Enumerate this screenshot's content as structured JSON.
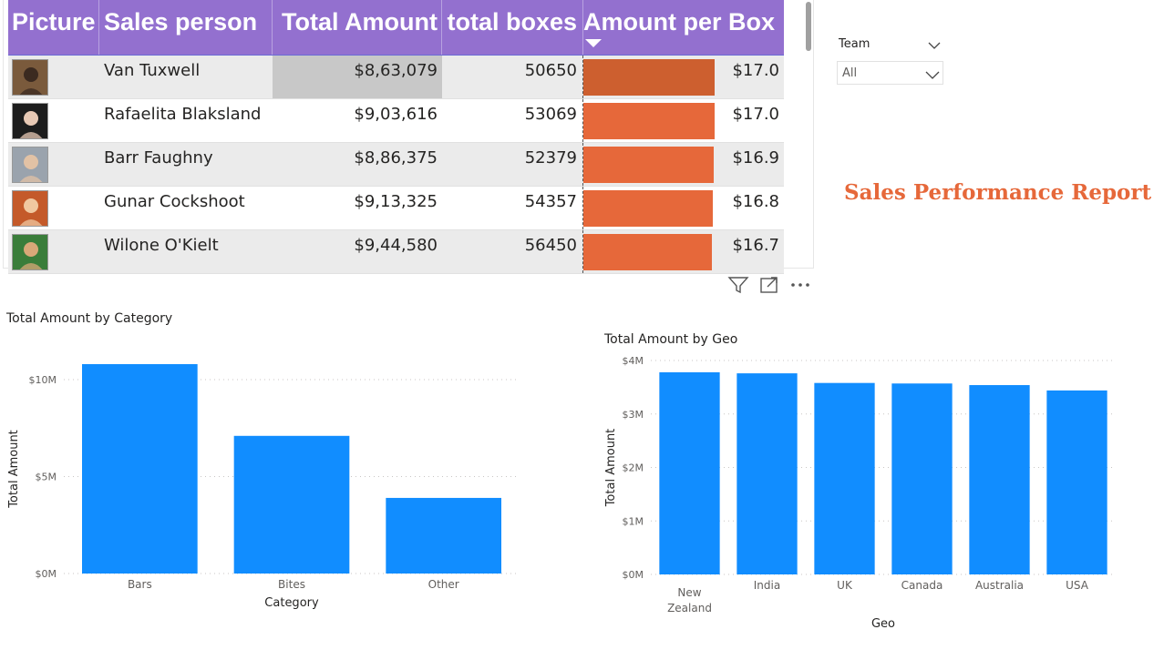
{
  "table": {
    "headers": {
      "picture": "Picture",
      "sales_person": "Sales person",
      "total_amount": "Total Amount",
      "total_boxes": "total boxes",
      "amount_per_box": "Amount per Box"
    },
    "sorted_column": "amount_per_box",
    "sort_direction": "descending",
    "header_color": "#9370cf",
    "databar_color": "#e6683a",
    "rows": [
      {
        "name": "Van Tuxwell",
        "amount": "$8,63,079",
        "boxes": "50650",
        "per_box": "$17.0",
        "per_box_value": 17.04,
        "selected": true
      },
      {
        "name": "Rafaelita Blaksland",
        "amount": "$9,03,616",
        "boxes": "53069",
        "per_box": "$17.0",
        "per_box_value": 17.03
      },
      {
        "name": "Barr Faughny",
        "amount": "$8,86,375",
        "boxes": "52379",
        "per_box": "$16.9",
        "per_box_value": 16.92
      },
      {
        "name": "Gunar Cockshoot",
        "amount": "$9,13,325",
        "boxes": "54357",
        "per_box": "$16.8",
        "per_box_value": 16.8
      },
      {
        "name": "Wilone O'Kielt",
        "amount": "$9,44,580",
        "boxes": "56450",
        "per_box": "$16.7",
        "per_box_value": 16.73
      }
    ]
  },
  "visual_header": {
    "icons": [
      "filter-icon",
      "focus-mode-icon",
      "more-options-icon"
    ]
  },
  "slicer": {
    "title": "Team",
    "value": "All"
  },
  "report_title": "Sales Performance Report",
  "chart_data": [
    {
      "type": "bar",
      "title": "Total Amount by Category",
      "xlabel": "Category",
      "ylabel": "Total Amount",
      "categories": [
        "Bars",
        "Bites",
        "Other"
      ],
      "values": [
        10800000,
        7100000,
        3900000
      ],
      "ylim": [
        0,
        10800000
      ],
      "yticks": [
        0,
        5000000,
        10000000
      ],
      "ytick_labels": [
        "$0M",
        "$5M",
        "$10M"
      ],
      "grid": true,
      "color": "#118dff"
    },
    {
      "type": "bar",
      "title": "Total Amount by Geo",
      "xlabel": "Geo",
      "ylabel": "Total Amount",
      "categories": [
        "New Zealand",
        "India",
        "UK",
        "Canada",
        "Australia",
        "USA"
      ],
      "values": [
        3780000,
        3760000,
        3580000,
        3570000,
        3540000,
        3440000
      ],
      "ylim": [
        0,
        4000000
      ],
      "yticks": [
        0,
        1000000,
        2000000,
        3000000,
        4000000
      ],
      "ytick_labels": [
        "$0M",
        "$1M",
        "$2M",
        "$3M",
        "$4M"
      ],
      "grid": true,
      "color": "#118dff"
    }
  ]
}
